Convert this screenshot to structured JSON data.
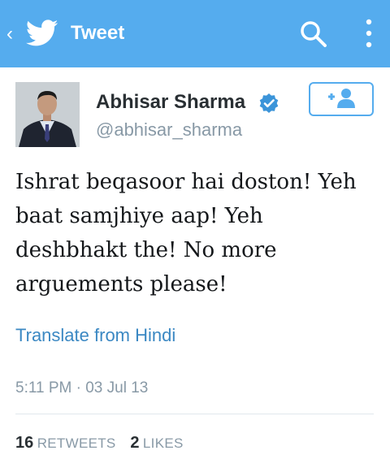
{
  "header": {
    "title": "Tweet",
    "back_icon": "chevron-left-icon",
    "logo_icon": "twitter-bird-icon",
    "search_icon": "search-icon",
    "menu_icon": "more-vertical-icon",
    "color": "#55acee"
  },
  "tweet": {
    "author_name": "Abhisar Sharma",
    "handle": "@abhisar_sharma",
    "verified_icon": "verified-badge-icon",
    "follow_icon": "add-user-icon",
    "text": "Ishrat beqasoor hai doston! Yeh baat samjhiye aap! Yeh deshbhakt the! No more arguements please!",
    "translate_label": "Translate from Hindi",
    "timestamp": "5:11 PM · 03 Jul 13"
  },
  "stats": {
    "retweets_count": "16",
    "retweets_label": "RETWEETS",
    "likes_count": "2",
    "likes_label": "LIKES"
  },
  "colors": {
    "link": "#3b88c3",
    "muted": "#8899a6",
    "text": "#14171a"
  }
}
